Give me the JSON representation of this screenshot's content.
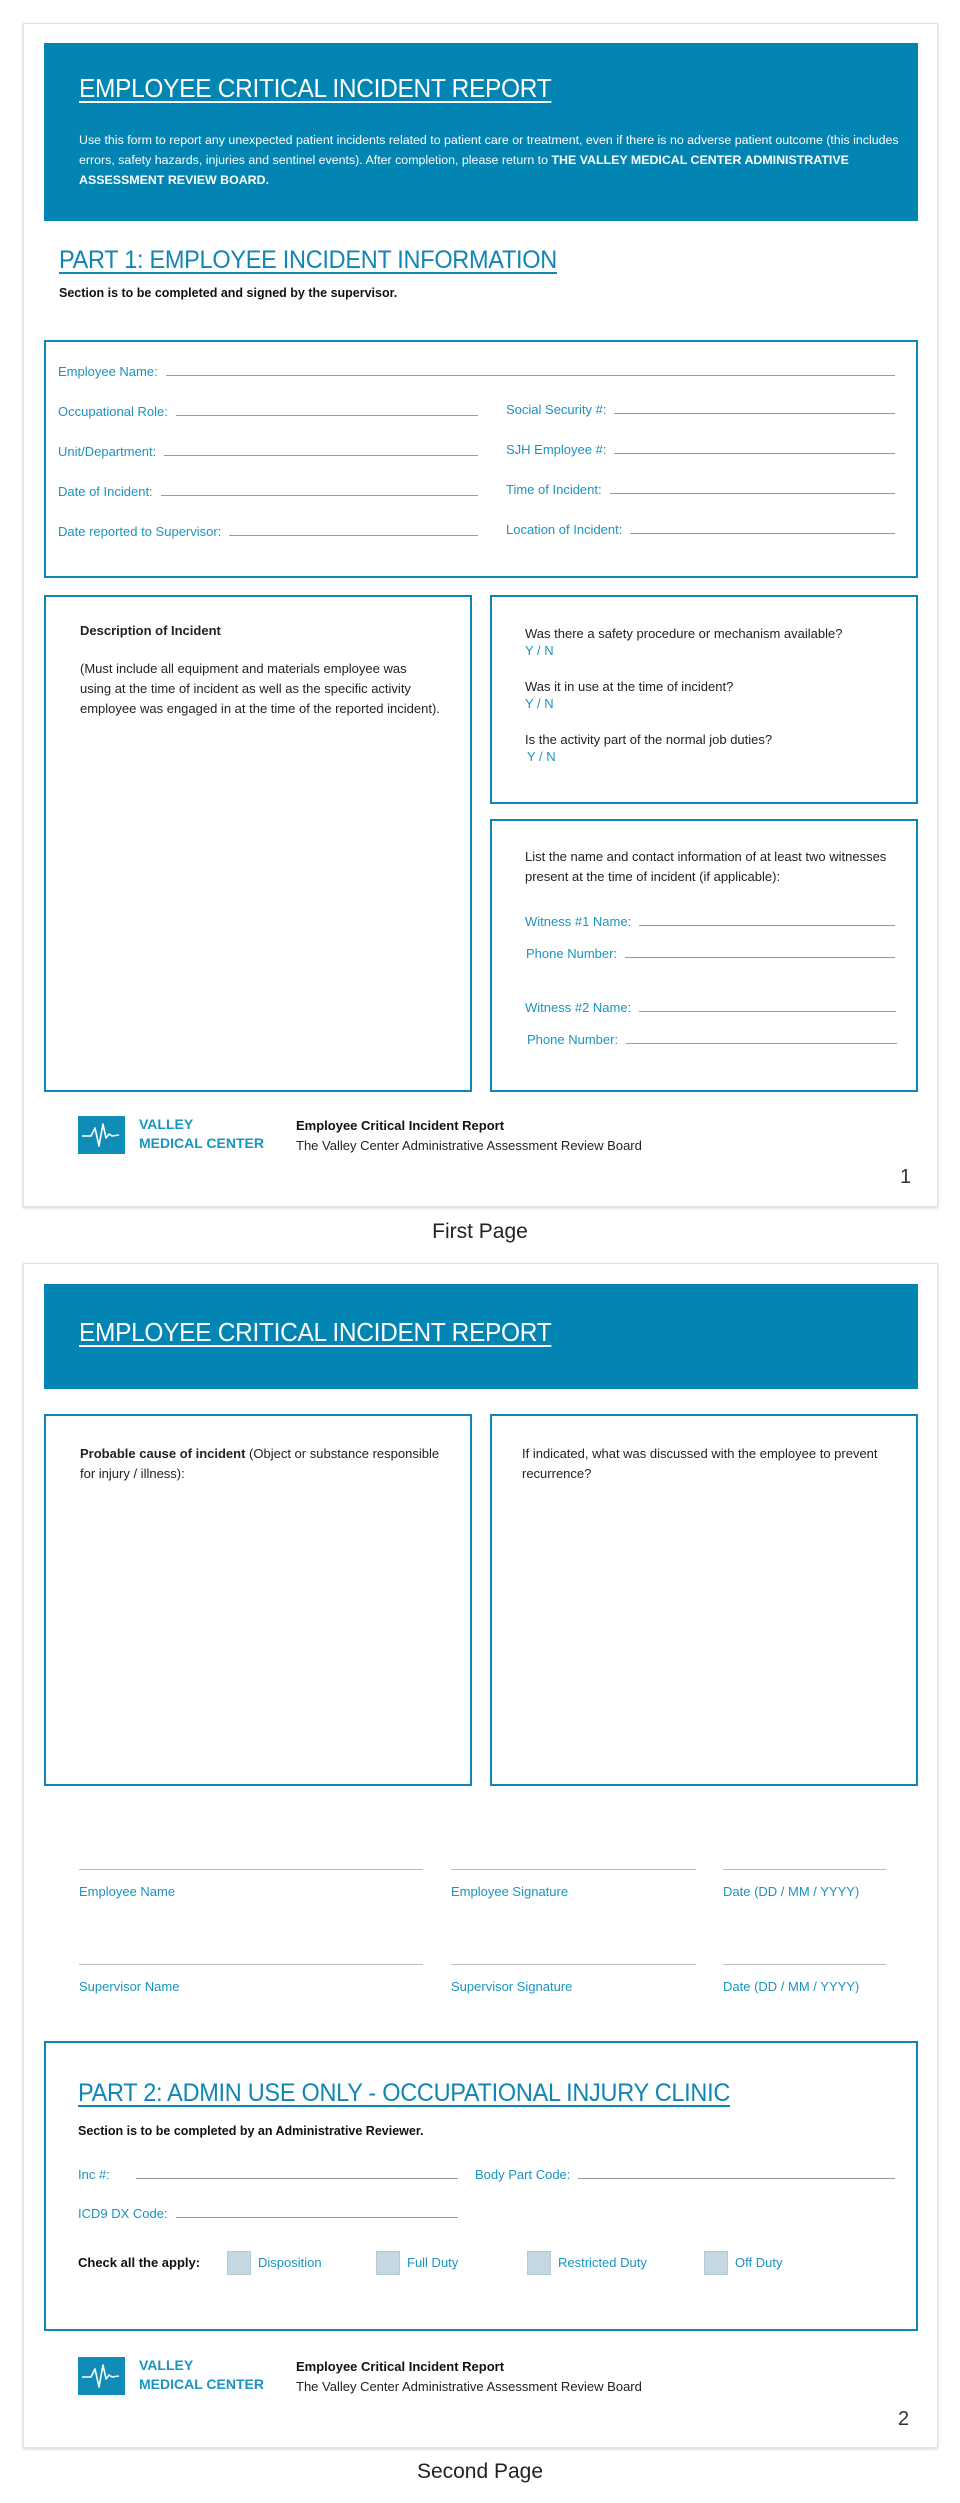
{
  "document": {
    "title": "EMPLOYEE CRITICAL INCIDENT REPORT",
    "accent_color": "#0285b2",
    "label_color": "#1a94c0"
  },
  "page1": {
    "banner": {
      "title": "EMPLOYEE CRITICAL INCIDENT REPORT",
      "description": "Use this form to report any unexpected patient incidents related to patient care or treatment, even if there is no adverse patient outcome (this includes errors, safety hazards, injuries and sentinel events). After completion, please return to ",
      "description_bold": "THE VALLEY MEDICAL CENTER ADMINISTRATIVE ASSESSMENT REVIEW BOARD."
    },
    "part1": {
      "title": "PART 1: EMPLOYEE INCIDENT INFORMATION",
      "subtitle": "Section is to be completed and signed by the supervisor.",
      "fields": {
        "employee_name": "Employee Name:",
        "occupational_role": "Occupational Role:",
        "social_security": "Social Security #:",
        "unit_department": "Unit/Department:",
        "sjh_employee": "SJH Employee #:",
        "date_of_incident": "Date of Incident:",
        "time_of_incident": "Time of Incident:",
        "date_reported": "Date reported to Supervisor:",
        "location_of_incident": "Location of Incident:"
      }
    },
    "description_box": {
      "heading": "Description of Incident",
      "text": "(Must include all equipment and materials employee was using at the time of incident as well as the specific activity employee was engaged in at the time of the reported incident)."
    },
    "questions": [
      {
        "question": "Was there a safety procedure or mechanism available?",
        "answer": "Y / N"
      },
      {
        "question": "Was it in use at the time of incident?",
        "answer": "Y / N"
      },
      {
        "question": "Is the activity part of the normal job duties?",
        "answer": "Y / N"
      }
    ],
    "witnesses": {
      "instructions": "List the name and contact information of at least two witnesses present at the time of incident (if applicable):",
      "witness1_name": "Witness #1 Name:",
      "witness1_phone": "Phone Number:",
      "witness2_name": "Witness #2 Name:",
      "witness2_phone": "Phone Number:"
    },
    "footer": {
      "brand_line1": "VALLEY",
      "brand_line2": "MEDICAL CENTER",
      "title": "Employee Critical Incident Report",
      "subtitle": "The Valley Center Administrative Assessment Review Board",
      "page_number": "1"
    },
    "caption": "First Page"
  },
  "page2": {
    "banner": {
      "title": "EMPLOYEE CRITICAL INCIDENT REPORT"
    },
    "probable_cause": {
      "bold": "Probable cause of incident",
      "text": " (Object or substance responsible for injury / illness):"
    },
    "recurrence": {
      "text": "If indicated, what was discussed with the employee to prevent recurrence?"
    },
    "signatures": [
      {
        "label": "Employee Name"
      },
      {
        "label": "Employee Signature"
      },
      {
        "label": "Date (DD / MM / YYYY)"
      },
      {
        "label": "Supervisor Name"
      },
      {
        "label": "Supervisor Signature"
      },
      {
        "label": "Date (DD / MM / YYYY)"
      }
    ],
    "part2": {
      "title": "PART 2: ADMIN USE ONLY - OCCUPATIONAL INJURY CLINIC",
      "subtitle": "Section is to be completed by an Administrative Reviewer.",
      "fields": {
        "inc": "Inc #:",
        "body_part_code": "Body Part Code:",
        "icd9": "ICD9 DX Code:"
      },
      "check_label": "Check all the apply:",
      "checkboxes": [
        {
          "label": "Disposition",
          "checked": false
        },
        {
          "label": "Full Duty",
          "checked": false
        },
        {
          "label": "Restricted Duty",
          "checked": false
        },
        {
          "label": "Off Duty",
          "checked": false
        }
      ]
    },
    "footer": {
      "brand_line1": "VALLEY",
      "brand_line2": "MEDICAL CENTER",
      "title": "Employee Critical Incident Report",
      "subtitle": "The Valley Center Administrative Assessment Review Board",
      "page_number": "2"
    },
    "caption": "Second Page"
  }
}
